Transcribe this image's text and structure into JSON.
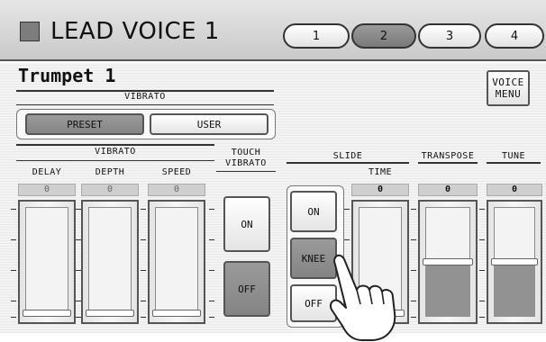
{
  "header": {
    "title": "LEAD VOICE 1",
    "tabs": [
      {
        "label": "1",
        "active": false
      },
      {
        "label": "2",
        "active": true
      },
      {
        "label": "3",
        "active": false
      },
      {
        "label": "4",
        "active": false
      }
    ]
  },
  "voice": {
    "name": "Trumpet 1"
  },
  "voice_menu": {
    "line1": "VOICE",
    "line2": "MENU"
  },
  "vibrato_mode": {
    "heading": "VIBRATO",
    "preset_label": "PRESET",
    "user_label": "USER",
    "selected": "PRESET"
  },
  "vibrato": {
    "heading": "VIBRATO",
    "delay": {
      "label": "DELAY",
      "value": "0",
      "level": 0
    },
    "depth": {
      "label": "DEPTH",
      "value": "0",
      "level": 0
    },
    "speed": {
      "label": "SPEED",
      "value": "0",
      "level": 0
    }
  },
  "touch_vibrato": {
    "line1": "TOUCH",
    "line2": "VIBRATO",
    "on_label": "ON",
    "off_label": "OFF",
    "selected": "OFF"
  },
  "slide": {
    "heading": "SLIDE",
    "on_label": "ON",
    "knee_label": "KNEE",
    "off_label": "OFF",
    "selected": "KNEE",
    "time": {
      "label": "TIME",
      "value": "0",
      "level": 0
    }
  },
  "transpose": {
    "heading": "TRANSPOSE",
    "value": "0",
    "level": 0.5
  },
  "tune": {
    "heading": "TUNE",
    "value": "0",
    "level": 0.5
  },
  "colors": {
    "accent": "#7d7d7d",
    "selected_button": "#929292"
  }
}
